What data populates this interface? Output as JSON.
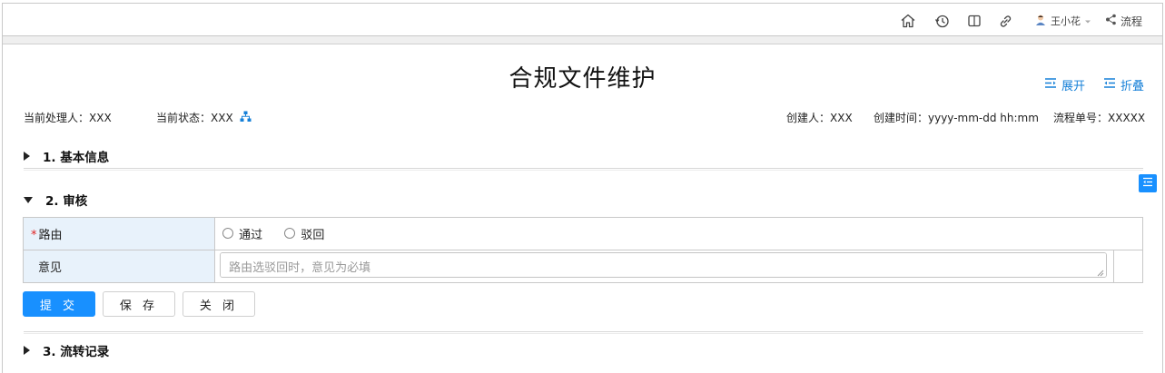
{
  "topbar": {
    "user_name": "王小花",
    "process_label": "流程"
  },
  "page": {
    "title": "合规文件维护",
    "expand_label": "展开",
    "collapse_label": "折叠"
  },
  "meta": {
    "handler_label": "当前处理人：XXX",
    "status_label": "当前状态：XXX",
    "creator_label": "创建人：XXX",
    "created_time_label": "创建时间：yyyy-mm-dd hh:mm",
    "flow_no_label": "流程单号：XXXXX"
  },
  "sections": {
    "basic": "1. 基本信息",
    "review": "2. 审核",
    "history": "3. 流转记录"
  },
  "form": {
    "route_label": "路由",
    "route_required_mark": "*",
    "route_options": [
      "通过",
      "驳回"
    ],
    "opinion_label": "意见",
    "opinion_placeholder": "路由选驳回时，意见为必填",
    "opinion_value": ""
  },
  "buttons": {
    "submit": "提 交",
    "save": "保 存",
    "close": "关 闭"
  },
  "colors": {
    "accent": "#1890ff",
    "link": "#1680d8",
    "label_bg": "#e8f2fb",
    "required": "#e02020"
  },
  "icons": [
    "home-icon",
    "history-icon",
    "book-icon",
    "link-icon",
    "user-avatar-icon",
    "chevron-down-icon",
    "flow-icon",
    "expand-icon",
    "collapse-icon",
    "org-chart-icon",
    "side-panel-icon"
  ]
}
